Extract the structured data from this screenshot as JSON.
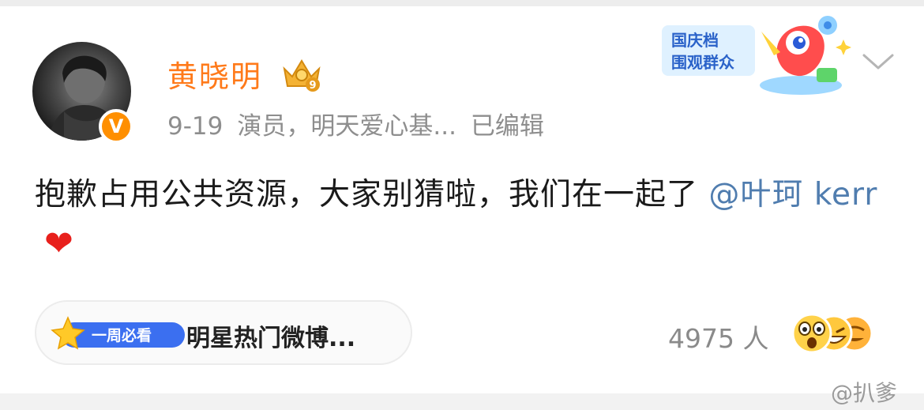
{
  "post": {
    "author": "黄晓明",
    "verified_badge": "V",
    "crown_level": "9",
    "date": "9-19",
    "bio": "演员，明天爱心基...",
    "edited": "已编辑",
    "content_text": "抱歉占用公共资源，大家别猜啦，我们在一起了",
    "mention": "@叶珂 kerr",
    "heart": "❤"
  },
  "promo": {
    "line1": "国庆档",
    "line2": "围观群众"
  },
  "topic": {
    "badge_label": "一周必看",
    "title": "明星热门微博..."
  },
  "reactions": {
    "count": "4975 人"
  },
  "watermark": "@扒爹",
  "colors": {
    "username": "#ff7a1a",
    "mention": "#507daf",
    "meta": "#8e8e8e",
    "heart": "#e8201c",
    "verified": "#ff8f00"
  }
}
